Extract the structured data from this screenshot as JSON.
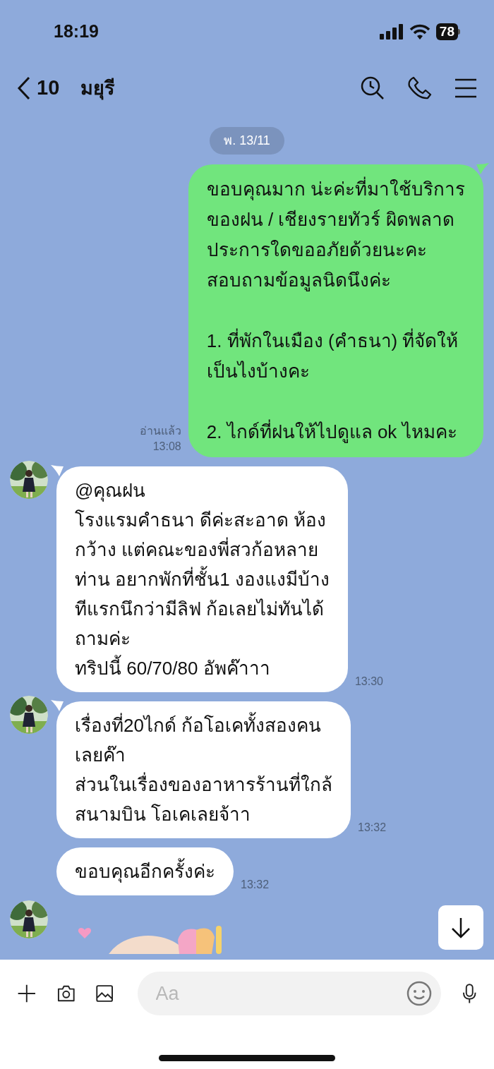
{
  "status_bar": {
    "time": "18:19",
    "battery": "78"
  },
  "header": {
    "back_count": "10",
    "contact_name": "มยุรี"
  },
  "date_badge": "พ. 13/11",
  "messages": [
    {
      "kind": "outgoing",
      "paragraphs": [
        [
          "ขอบคุณมาก น่ะค่ะที่มาใช้บริการ",
          "ของฝน / เชียงรายทัวร์ ผิดพลาด",
          "ประการใดขออภัยด้วยนะคะ",
          "สอบถามข้อมูลนิดนึงค่ะ"
        ],
        [
          "1. ที่พักในเมือง (คำธนา) ที่จัดให้",
          "เป็นไงบ้างคะ"
        ],
        [
          "2. ไกด์ที่ฝนให้ไปดูแล ok ไหมคะ"
        ]
      ],
      "read": "อ่านแล้ว",
      "time": "13:08"
    },
    {
      "kind": "incoming",
      "avatar": true,
      "paragraphs": [
        [
          "@คุณฝน",
          "โรงแรมคำธนา ดีค่ะสะอาด ห้อง",
          "กว้าง แต่คณะของพี่สวก้อหลาย",
          "ท่าน อยากพักที่ชั้น1 งองแงมีบ้าง",
          "ทีแรกนึกว่ามีลิฟ ก้อเลยไม่ทันได้",
          "ถามค่ะ",
          "ทริปนี้ 60/70/80 อัพค๊าาา"
        ]
      ],
      "time": "13:30"
    },
    {
      "kind": "incoming",
      "avatar": true,
      "paragraphs": [
        [
          "เรื่องที่20ไกด์ ก้อโอเคทั้งสองคน",
          "เลยค๊า",
          "ส่วนในเรื่องของอาหารร้านที่ใกล้",
          "สนามบิน โอเคเลยจ้าา"
        ]
      ],
      "time": "13:32"
    },
    {
      "kind": "incoming",
      "avatar": false,
      "paragraphs": [
        [
          "ขอบคุณอีกครั้งค่ะ"
        ]
      ],
      "time": "13:32"
    },
    {
      "kind": "sticker",
      "avatar": true
    }
  ],
  "composer": {
    "placeholder": "Aa"
  }
}
